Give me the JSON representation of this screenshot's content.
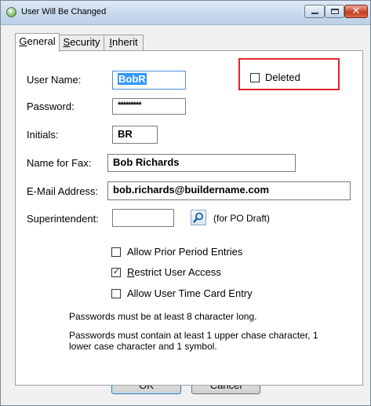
{
  "window": {
    "title": "User Will Be Changed",
    "close_glyph": "✕"
  },
  "tabs": [
    {
      "accel": "G",
      "rest": "eneral",
      "active": true
    },
    {
      "accel": "S",
      "rest": "ecurity",
      "active": false
    },
    {
      "accel": "I",
      "rest": "nherit",
      "active": false
    }
  ],
  "form": {
    "user_name_label": "User Name:",
    "user_name_value": "BobR",
    "password_label": "Password:",
    "password_value": "*********",
    "initials_label": "Initials:",
    "initials_value": "BR",
    "fax_name_label": "Name for Fax:",
    "fax_name_value": "Bob Richards",
    "email_label": "E-Mail Address:",
    "email_value": "bob.richards@buildername.com",
    "superintendent_label": "Superintendent:",
    "superintendent_value": "",
    "po_draft_note": "(for PO Draft)"
  },
  "deleted": {
    "label": "Deleted",
    "checked": false
  },
  "checkboxes": [
    {
      "accel": "",
      "label": "Allow Prior Period Entries",
      "checked": false
    },
    {
      "accel": "R",
      "label": "estrict User Access",
      "checked": true
    },
    {
      "accel": "",
      "label": "Allow User Time Card Entry",
      "checked": false
    }
  ],
  "notes": {
    "min_length": "Passwords must be at least 8 character long.",
    "complexity_line1": "Passwords must contain at least 1 upper chase character, 1",
    "complexity_line2": "lower case character and 1 symbol."
  },
  "buttons": {
    "ok": "OK",
    "cancel": "Cancel"
  },
  "icons": {
    "app": "app-icon",
    "lookup": "magnifier-icon",
    "check_mark": "✓"
  },
  "colors": {
    "highlight_border": "#e0242b",
    "selection": "#3399ff",
    "close_button": "#c03a1f"
  }
}
